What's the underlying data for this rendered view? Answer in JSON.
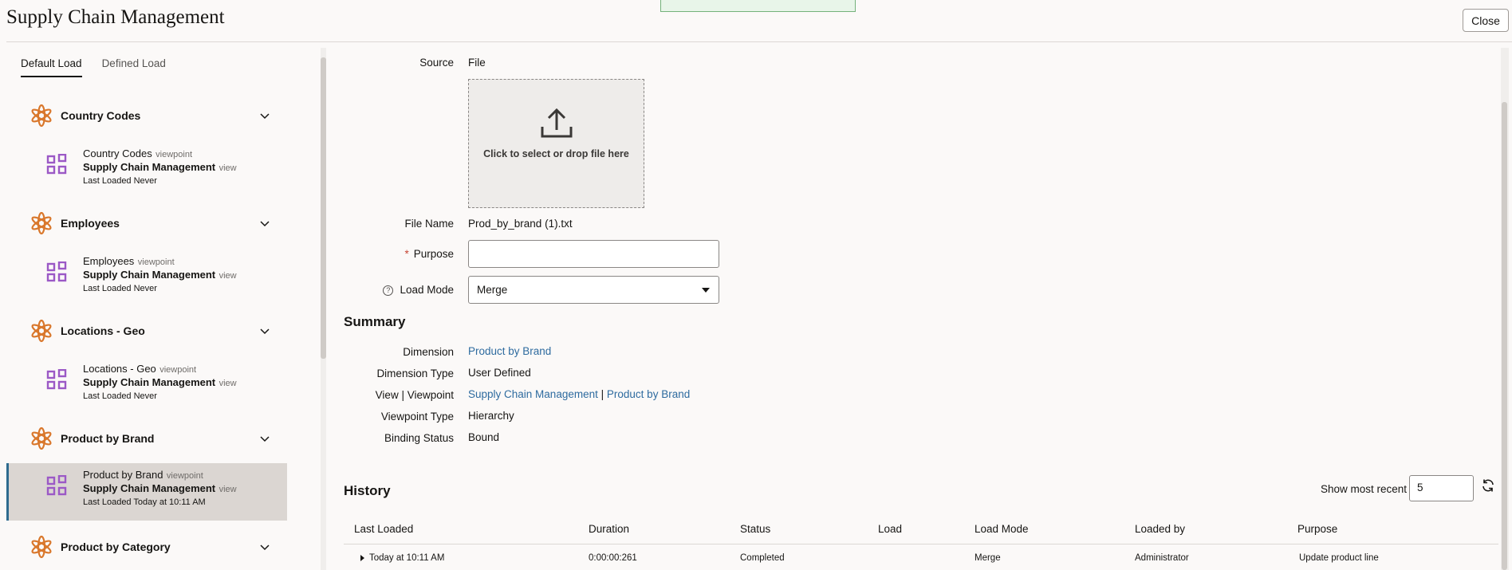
{
  "app": {
    "title": "Supply Chain Management",
    "close_label": "Close"
  },
  "tabs": [
    {
      "label": "Default Load",
      "active": true
    },
    {
      "label": "Defined Load",
      "active": false
    }
  ],
  "groups": [
    {
      "name": "Country Codes",
      "viewpoint": "Country Codes",
      "kind": "viewpoint",
      "view": "Supply Chain Management",
      "view_kind": "view",
      "last_loaded": "Last Loaded Never",
      "selected": false
    },
    {
      "name": "Employees",
      "viewpoint": "Employees",
      "kind": "viewpoint",
      "view": "Supply Chain Management",
      "view_kind": "view",
      "last_loaded": "Last Loaded Never",
      "selected": false
    },
    {
      "name": "Locations - Geo",
      "viewpoint": "Locations - Geo",
      "kind": "viewpoint",
      "view": "Supply Chain Management",
      "view_kind": "view",
      "last_loaded": "Last Loaded Never",
      "selected": false
    },
    {
      "name": "Product by Brand",
      "viewpoint": "Product by Brand",
      "kind": "viewpoint",
      "view": "Supply Chain Management",
      "view_kind": "view",
      "last_loaded": "Last Loaded Today at 10:11 AM",
      "selected": true
    },
    {
      "name": "Product by Category"
    }
  ],
  "form": {
    "source_label": "Source",
    "source_value": "File",
    "dropzone_text": "Click to select or drop file here",
    "file_name_label": "File Name",
    "file_name_value": "Prod_by_brand (1).txt",
    "purpose_required": "*",
    "purpose_label": "Purpose",
    "purpose_value": "",
    "load_mode_label": "Load Mode",
    "load_mode_value": "Merge"
  },
  "summary": {
    "title": "Summary",
    "dimension_label": "Dimension",
    "dimension_value": "Product by Brand",
    "dimension_type_label": "Dimension Type",
    "dimension_type_value": "User Defined",
    "view_viewpoint_label": "View | Viewpoint",
    "view_value": "Supply Chain Management",
    "separator": "|",
    "viewpoint_value": "Product by Brand",
    "viewpoint_type_label": "Viewpoint Type",
    "viewpoint_type_value": "Hierarchy",
    "binding_status_label": "Binding Status",
    "binding_status_value": "Bound"
  },
  "history": {
    "title": "History",
    "show_recent_label": "Show most recent",
    "show_recent_value": "5",
    "columns": [
      "Last Loaded",
      "Duration",
      "Status",
      "Load",
      "Load Mode",
      "Loaded by",
      "Purpose"
    ],
    "rows": [
      [
        "Today at 10:11 AM",
        "0:00:00:261",
        "Completed",
        "",
        "Merge",
        "Administrator",
        "Update product line"
      ]
    ]
  },
  "colors": {
    "accent_orange": "#d9772b",
    "viewpoint_purple": "#9b59c6",
    "link_blue": "#2e6b9f"
  }
}
